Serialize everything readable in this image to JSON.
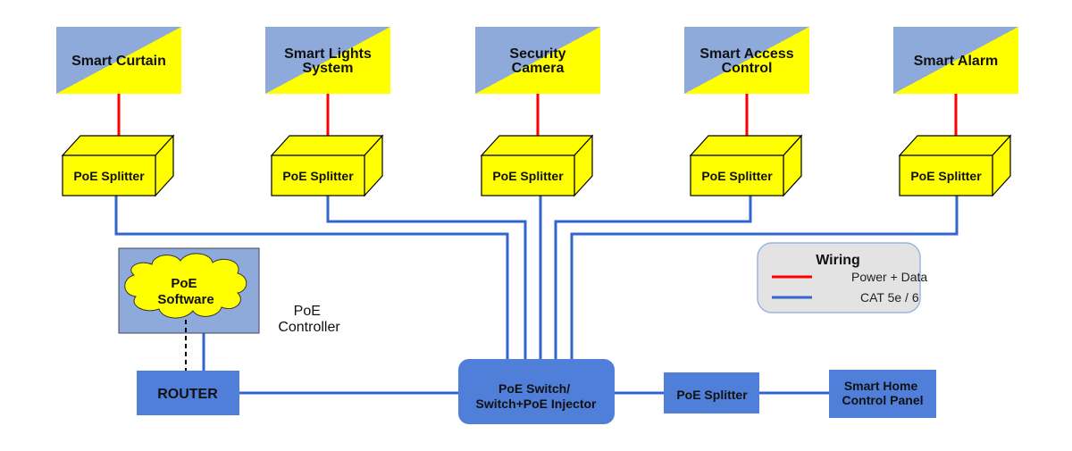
{
  "colors": {
    "device_blue": "#8eaadb",
    "device_yellow": "#ffff00",
    "power_data_wire": "#ff0000",
    "cat_wire": "#3366cc",
    "box_blue": "#4f7fd9",
    "legend_bg": "#e3e3e3"
  },
  "devices": [
    {
      "lines": [
        "Smart Curtain"
      ]
    },
    {
      "lines": [
        "Smart Lights",
        "System"
      ]
    },
    {
      "lines": [
        "Security",
        "Camera"
      ]
    },
    {
      "lines": [
        "Smart Access",
        "Control"
      ]
    },
    {
      "lines": [
        "Smart Alarm"
      ]
    }
  ],
  "splitter_label": "PoE Splitter",
  "controller": {
    "cloud_lines": [
      "PoE",
      "Software"
    ],
    "label_lines": [
      "PoE",
      "Controller"
    ]
  },
  "router_label": "ROUTER",
  "switch_lines": [
    "PoE Switch/",
    "Switch+PoE Injector"
  ],
  "bottom_splitter_label": "PoE Splitter",
  "control_panel_lines": [
    "Smart Home",
    "Control Panel"
  ],
  "legend": {
    "title": "Wiring",
    "items": [
      {
        "label": "Power + Data",
        "color": "#ff0000"
      },
      {
        "label": "CAT 5e / 6",
        "color": "#3366cc"
      }
    ]
  }
}
